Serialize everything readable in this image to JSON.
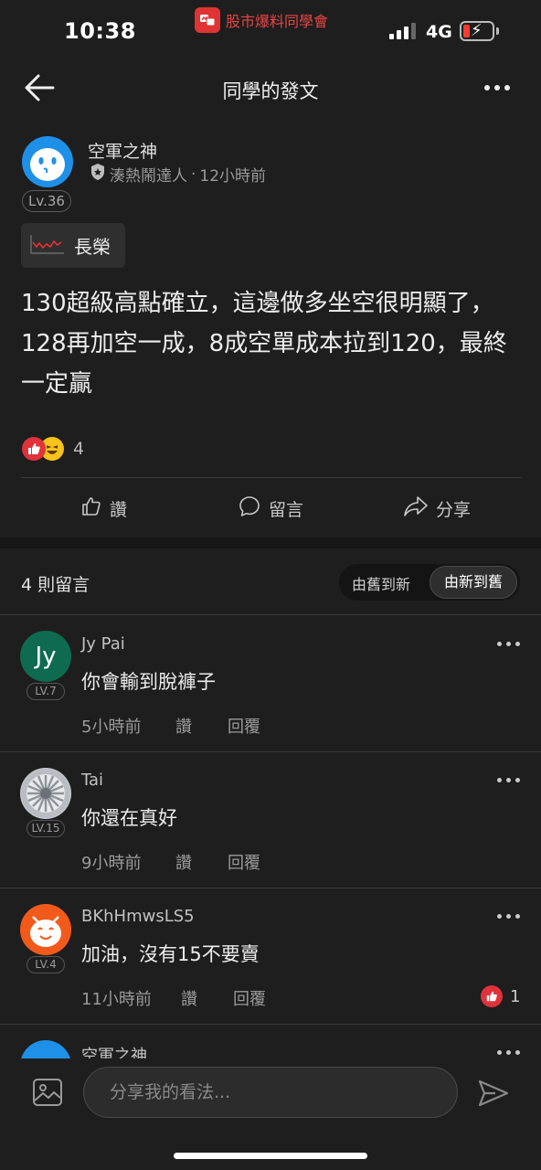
{
  "status_bar": {
    "time": "10:38",
    "app_name": "股市爆料同學會",
    "network": "4G"
  },
  "header": {
    "title": "同學的發文"
  },
  "post": {
    "author": {
      "name": "空軍之神",
      "level": "Lv.36",
      "title": "湊熱鬧達人",
      "time": "12小時前"
    },
    "stock_tag": "長榮",
    "body": "130超級高點確立，這邊做多坐空很明顯了，128再加空一成，8成空單成本拉到120，最終一定贏",
    "reaction_count": "4",
    "actions": {
      "like": "讚",
      "comment": "留言",
      "share": "分享"
    }
  },
  "comments_section": {
    "count_label": "4 則留言",
    "sort_old_to_new": "由舊到新",
    "sort_new_to_old": "由新到舊",
    "comments": [
      {
        "avatar_text": "Jy",
        "name": "Jy Pai",
        "level": "LV.7",
        "text": "你會輸到脫褲子",
        "time": "5小時前",
        "like": "讚",
        "reply": "回覆",
        "reaction_count": ""
      },
      {
        "avatar_text": "",
        "name": "Tai",
        "level": "LV.15",
        "text": "你還在真好",
        "time": "9小時前",
        "like": "讚",
        "reply": "回覆",
        "reaction_count": ""
      },
      {
        "avatar_text": "",
        "name": "BKhHmwsLS5",
        "level": "LV.4",
        "text": "加油，沒有15不要賣",
        "time": "11小時前",
        "like": "讚",
        "reply": "回覆",
        "reaction_count": "1"
      },
      {
        "avatar_text": "",
        "name": "空軍之神",
        "level": "",
        "text": "",
        "time": "",
        "like": "",
        "reply": "",
        "reaction_count": ""
      }
    ]
  },
  "composer": {
    "placeholder": "分享我的看法..."
  },
  "colors": {
    "background": "#1e1e1e",
    "brand_red": "#e03434",
    "author_avatar": "#1e90e8",
    "jy_avatar": "#0f6b4f",
    "orange_avatar": "#f25a1c"
  },
  "icons": [
    "back-arrow-icon",
    "more-dots-icon",
    "shield-icon",
    "stock-chart-icon",
    "thumbs-up-icon",
    "chat-bubble-icon",
    "share-arrow-icon",
    "image-icon",
    "send-icon"
  ]
}
